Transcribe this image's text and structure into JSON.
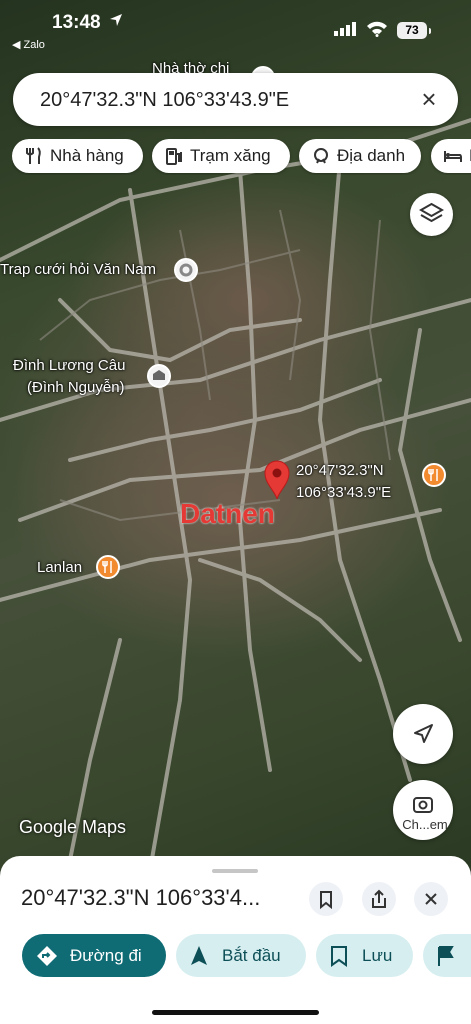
{
  "status_bar": {
    "time": "13:48",
    "back_app": "◀ Zalo",
    "battery": "73"
  },
  "search": {
    "value": "20°47'32.3\"N 106°33'43.9\"E"
  },
  "chips": [
    {
      "label": "Nhà hàng",
      "icon": "restaurant-icon"
    },
    {
      "label": "Trạm xăng",
      "icon": "gas-station-icon"
    },
    {
      "label": "Địa danh",
      "icon": "landmark-icon"
    },
    {
      "label": "K",
      "icon": "hotel-icon"
    }
  ],
  "map": {
    "labels": {
      "church": "Nhà thờ chi",
      "wedding": "Trap cưới hỏi Văn Nam",
      "temple_line1": "Đình Lương Câu",
      "temple_line2": "(Đình Nguyễn)",
      "lanlan": "Lanlan",
      "pin_line1": "20°47'32.3\"N",
      "pin_line2": "106°33'43.9\"E",
      "watermark": "Datnen",
      "logo": "Google Maps"
    },
    "street_view_label": "Ch...em"
  },
  "sheet": {
    "title": "20°47'32.3\"N 106°33'4...",
    "actions": [
      {
        "label": "Đường đi",
        "icon": "directions-icon",
        "style": "primary"
      },
      {
        "label": "Bắt đầu",
        "icon": "navigation-arrow-icon",
        "style": "secondary"
      },
      {
        "label": "Lưu",
        "icon": "bookmark-icon",
        "style": "secondary"
      },
      {
        "label": "",
        "icon": "flag-icon",
        "style": "secondary"
      }
    ]
  },
  "colors": {
    "accent": "#0f6b74",
    "pin": "#e53935",
    "food_poi": "#f28b30"
  }
}
